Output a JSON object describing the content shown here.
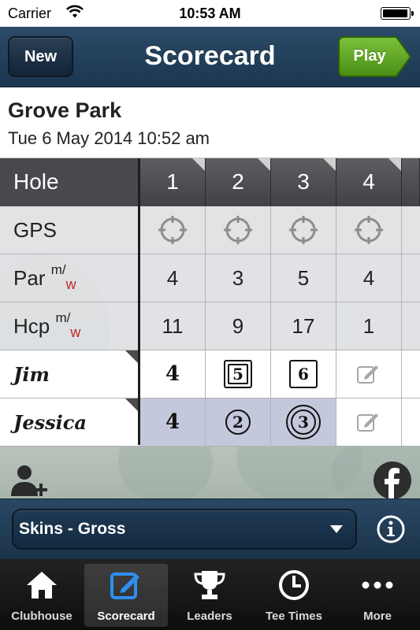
{
  "status_bar": {
    "carrier": "Carrier",
    "time": "10:53 AM"
  },
  "nav": {
    "title": "Scorecard",
    "new_label": "New",
    "play_label": "Play"
  },
  "course": {
    "name": "Grove Park",
    "date": "Tue 6 May 2014 10:52 am"
  },
  "grid": {
    "hole_label": "Hole",
    "holes": [
      "1",
      "2",
      "3",
      "4"
    ],
    "gps_label": "GPS",
    "par_label": "Par",
    "hcp_label": "Hcp",
    "gender_m": "m",
    "gender_slash": "/",
    "gender_w": "w",
    "par_values": [
      "4",
      "3",
      "5",
      "4"
    ],
    "hcp_values": [
      "11",
      "9",
      "17",
      "1"
    ],
    "players": [
      {
        "name": "Jim",
        "scores": [
          "4",
          "5",
          "6",
          ""
        ]
      },
      {
        "name": "Jessica",
        "scores": [
          "4",
          "2",
          "3",
          ""
        ]
      }
    ]
  },
  "game": {
    "selected": "Skins - Gross"
  },
  "tabs": [
    {
      "label": "Clubhouse",
      "icon": "house-icon"
    },
    {
      "label": "Scorecard",
      "icon": "pencil-square-icon"
    },
    {
      "label": "Leaders",
      "icon": "trophy-icon"
    },
    {
      "label": "Tee Times",
      "icon": "clock-icon"
    },
    {
      "label": "More",
      "icon": "ellipsis-icon"
    }
  ],
  "colors": {
    "nav_bg": "#1f3a55",
    "play_green": "#5ea623",
    "active_tab": "#2e8ff0",
    "highlight_cell": "#c3c8dc",
    "gender_w": "#c0262a"
  }
}
